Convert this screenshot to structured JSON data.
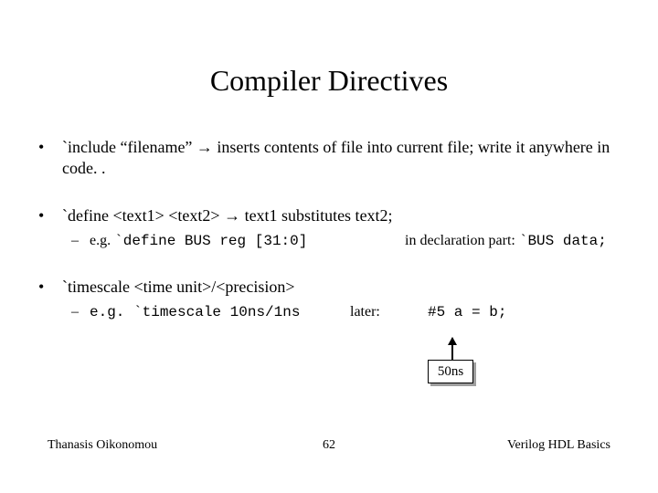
{
  "title": "Compiler Directives",
  "bullets": {
    "b1": {
      "text_pre": "`include “filename” ",
      "arrow": "→",
      "text_post": " inserts contents of file into current file; write it anywhere in code. ."
    },
    "b2": {
      "text_pre": "`define <text1> <text2> ",
      "arrow": "→",
      "text_post": " text1 substitutes text2;",
      "sub": {
        "lead": "e.g. ",
        "code": "`define BUS reg [31:0]",
        "mid": "in declaration part:  ",
        "code2": "`BUS data;"
      }
    },
    "b3": {
      "text": "`timescale <time unit>/<precision>",
      "sub": {
        "lead": "e.g. ",
        "code": "`timescale 10ns/1ns",
        "mid": "later:",
        "code2": "#5 a = b;"
      }
    }
  },
  "annotation": {
    "box": "50ns"
  },
  "footer": {
    "left": "Thanasis Oikonomou",
    "center": "62",
    "right": "Verilog HDL Basics"
  }
}
